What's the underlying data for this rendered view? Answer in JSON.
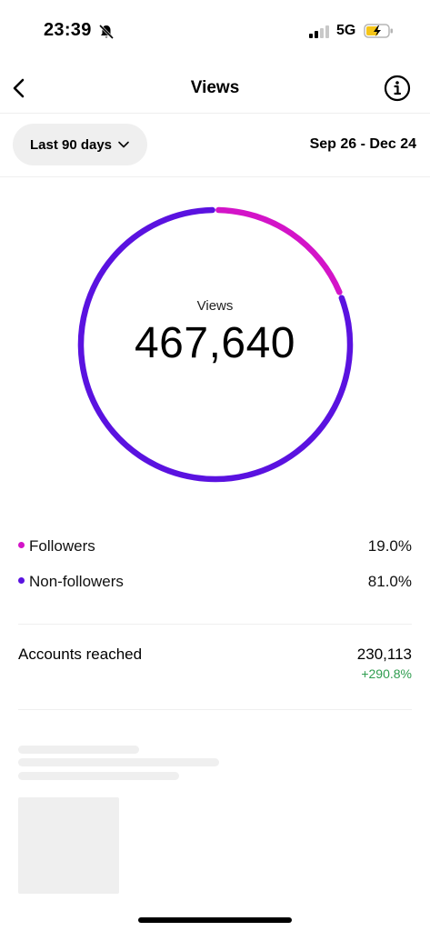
{
  "status_bar": {
    "time": "23:39",
    "network": "5G",
    "icons": [
      "bell-muted-icon",
      "signal-icon",
      "battery-charging-icon"
    ]
  },
  "header": {
    "title": "Views",
    "back_icon": "chevron-left-icon",
    "info_icon": "info-icon"
  },
  "filter": {
    "range_label": "Last 90 days",
    "date_range": "Sep 26 - Dec 24"
  },
  "summary": {
    "label": "Views",
    "value": "467,640"
  },
  "chart_data": {
    "type": "pie",
    "categories": [
      "Followers",
      "Non-followers"
    ],
    "values": [
      19.0,
      81.0
    ],
    "colors": [
      "#d314c8",
      "#5a12e0"
    ]
  },
  "breakdown": [
    {
      "label": "Followers",
      "percent": "19.0%",
      "color": "#d314c8"
    },
    {
      "label": "Non-followers",
      "percent": "81.0%",
      "color": "#5a12e0"
    }
  ],
  "accounts_reached": {
    "label": "Accounts reached",
    "value": "230,113",
    "change": "+290.8%",
    "change_color": "#2f9d4f"
  }
}
